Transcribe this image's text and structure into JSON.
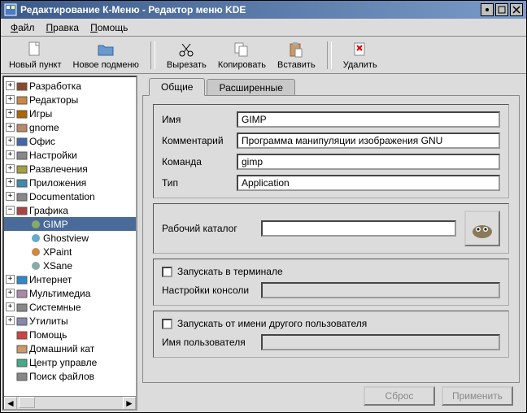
{
  "title": "Редактирование К-Меню - Редактор меню KDE",
  "menubar": {
    "file": "Файл",
    "edit": "Правка",
    "help": "Помощь"
  },
  "toolbar": {
    "new_item": "Новый пункт",
    "new_submenu": "Новое подменю",
    "cut": "Вырезать",
    "copy": "Копировать",
    "paste": "Вставить",
    "delete": "Удалить"
  },
  "tree": {
    "items": [
      {
        "label": "Разработка",
        "exp": "+"
      },
      {
        "label": "Редакторы",
        "exp": "+"
      },
      {
        "label": "Игры",
        "exp": "+"
      },
      {
        "label": "gnome",
        "exp": "+"
      },
      {
        "label": "Офис",
        "exp": "+"
      },
      {
        "label": "Настройки",
        "exp": "+"
      },
      {
        "label": "Развлечения",
        "exp": "+"
      },
      {
        "label": "Приложения",
        "exp": "+"
      },
      {
        "label": "Documentation",
        "exp": "+"
      },
      {
        "label": "Графика",
        "exp": "−"
      },
      {
        "label": "Интернет",
        "exp": "+"
      },
      {
        "label": "Мультимедиа",
        "exp": "+"
      },
      {
        "label": "Системные",
        "exp": "+"
      },
      {
        "label": "Утилиты",
        "exp": "+"
      },
      {
        "label": "Помощь",
        "exp": ""
      },
      {
        "label": "Домашний кат",
        "exp": ""
      },
      {
        "label": "Центр управле",
        "exp": ""
      },
      {
        "label": "Поиск файлов",
        "exp": ""
      }
    ],
    "subitems": [
      "GIMP",
      "Ghostview",
      "XPaint",
      "XSane"
    ]
  },
  "tabs": {
    "general": "Общие",
    "advanced": "Расширенные"
  },
  "fields": {
    "name_lbl": "Имя",
    "name_val": "GIMP",
    "comment_lbl": "Комментарий",
    "comment_val": "Программа манипуляции изображения GNU",
    "command_lbl": "Команда",
    "command_val": "gimp",
    "type_lbl": "Тип",
    "type_val": "Application",
    "workdir_lbl": "Рабочий каталог",
    "workdir_val": "",
    "terminal_lbl": "Запускать в терминале",
    "console_lbl": "Настройки консоли",
    "runas_lbl": "Запускать от имени другого пользователя",
    "user_lbl": "Имя пользователя"
  },
  "buttons": {
    "reset": "Сброс",
    "apply": "Применить"
  }
}
